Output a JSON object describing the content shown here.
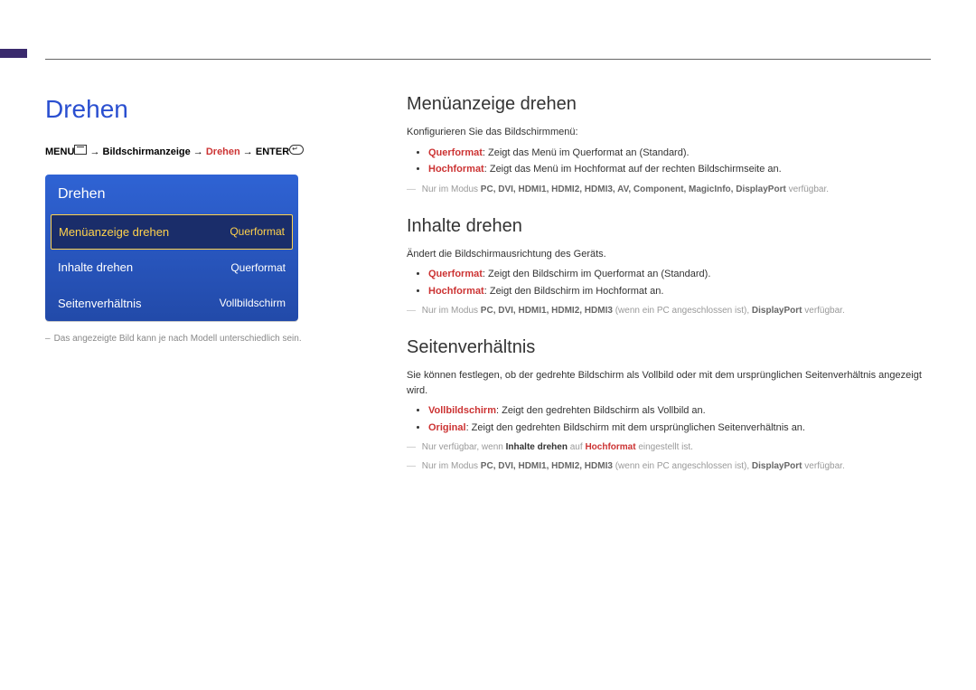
{
  "title": "Drehen",
  "breadcrumb": {
    "menu": "MENU",
    "path1": "Bildschirmanzeige",
    "path2": "Drehen",
    "enter": "ENTER"
  },
  "menu": {
    "title": "Drehen",
    "items": [
      {
        "label": "Menüanzeige drehen",
        "value": "Querformat",
        "selected": true
      },
      {
        "label": "Inhalte drehen",
        "value": "Querformat",
        "selected": false
      },
      {
        "label": "Seitenverhältnis",
        "value": "Vollbildschirm",
        "selected": false
      }
    ]
  },
  "footnote_img": "Das angezeigte Bild kann je nach Modell unterschiedlich sein.",
  "sections": {
    "s1": {
      "heading": "Menüanzeige drehen",
      "intro": "Konfigurieren Sie das Bildschirmmenü:",
      "b1_term": "Querformat",
      "b1_rest": ": Zeigt das Menü im Querformat an (Standard).",
      "b2_term": "Hochformat",
      "b2_rest": ": Zeigt das Menü im Hochformat auf der rechten Bildschirmseite an.",
      "note_pre": "Nur im Modus ",
      "note_modes": "PC, DVI, HDMI1, HDMI2, HDMI3, AV, Component, MagicInfo, DisplayPort",
      "note_post": " verfügbar."
    },
    "s2": {
      "heading": "Inhalte drehen",
      "intro": "Ändert die Bildschirmausrichtung des Geräts.",
      "b1_term": "Querformat",
      "b1_rest": ": Zeigt den Bildschirm im Querformat an (Standard).",
      "b2_term": "Hochformat",
      "b2_rest": ": Zeigt den Bildschirm im Hochformat an.",
      "note_pre": "Nur im Modus ",
      "note_modes": "PC, DVI, HDMI1, HDMI2, HDMI3",
      "note_mid": " (wenn ein PC angeschlossen ist), ",
      "note_dp": "DisplayPort",
      "note_post": " verfügbar."
    },
    "s3": {
      "heading": "Seitenverhältnis",
      "intro": "Sie können festlegen, ob der gedrehte Bildschirm als Vollbild oder mit dem ursprünglichen Seitenverhältnis angezeigt wird.",
      "b1_term": "Vollbildschirm",
      "b1_rest": ": Zeigt den gedrehten Bildschirm als Vollbild an.",
      "b2_term": "Original",
      "b2_rest": ": Zeigt den gedrehten Bildschirm mit dem ursprünglichen Seitenverhältnis an.",
      "note1_pre": "Nur verfügbar, wenn ",
      "note1_b": "Inhalte drehen",
      "note1_mid": " auf ",
      "note1_hf": "Hochformat",
      "note1_post": " eingestellt ist.",
      "note2_pre": "Nur im Modus ",
      "note2_modes": "PC, DVI, HDMI1, HDMI2, HDMI3",
      "note2_mid": " (wenn ein PC angeschlossen ist), ",
      "note2_dp": "DisplayPort",
      "note2_post": " verfügbar."
    }
  }
}
